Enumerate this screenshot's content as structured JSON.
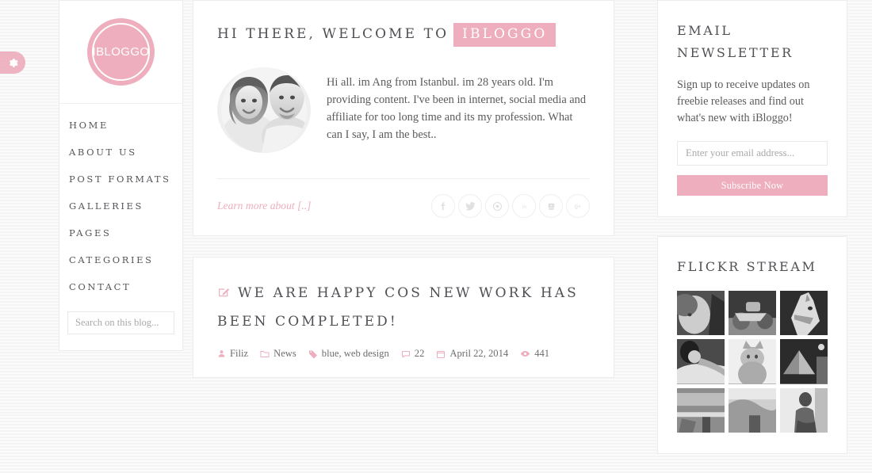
{
  "theme": {
    "accent": "#eeaebe",
    "text_dark": "#4f5054",
    "text_body": "#5b5b5b",
    "panel_bg": "#ffffff",
    "page_bg": "#f7f7f7"
  },
  "gear_tab": {
    "icon": "gear-icon"
  },
  "sidebar": {
    "logo_text": "IBLOGGO",
    "nav": [
      {
        "label": "HOME"
      },
      {
        "label": "ABOUT US"
      },
      {
        "label": "POST FORMATS"
      },
      {
        "label": "GALLERIES"
      },
      {
        "label": "PAGES"
      },
      {
        "label": "CATEGORIES"
      },
      {
        "label": "CONTACT"
      }
    ],
    "search": {
      "placeholder": "Search on this blog...",
      "value": ""
    }
  },
  "welcome": {
    "title_plain": "HI THERE, WELCOME TO",
    "title_highlight": "IBLOGGO",
    "avatar_alt": "two-people-photo",
    "body": "Hi all. im Ang from Istanbul. im 28 years old. I'm providing content. I've been in internet, social media and affiliate for too long time and its my profession. What can I say, I am the best..",
    "learn_more": "Learn more about [..]",
    "socials": [
      {
        "name": "facebook-icon",
        "glyph": "f"
      },
      {
        "name": "twitter-icon",
        "glyph": "t"
      },
      {
        "name": "pinterest-icon",
        "glyph": "p"
      },
      {
        "name": "linkedin-icon",
        "glyph": "in"
      },
      {
        "name": "youtube-icon",
        "glyph": "yt"
      },
      {
        "name": "googleplus-icon",
        "glyph": "g+"
      }
    ]
  },
  "post": {
    "title": "WE ARE HAPPY COS NEW WORK HAS BEEN COMPLETED!",
    "meta": {
      "author": "Filiz",
      "category": "News",
      "tags": "blue, web design",
      "comments": "22",
      "date": "April 22, 2014",
      "views": "441"
    }
  },
  "newsletter": {
    "title": "EMAIL NEWSLETTER",
    "text": "Sign up to receive updates on freebie releases and find out what's new with iBloggo!",
    "input_placeholder": "Enter your email address...",
    "input_value": "",
    "button_label": "Subscribe Now"
  },
  "flickr": {
    "title": "FLICKR STREAM",
    "thumbs": [
      {
        "alt": "portrait-woman"
      },
      {
        "alt": "motorcycle"
      },
      {
        "alt": "horse-head"
      },
      {
        "alt": "woman-resting"
      },
      {
        "alt": "cat"
      },
      {
        "alt": "louvre-pyramid"
      },
      {
        "alt": "blue-machinery"
      },
      {
        "alt": "blurred-scene"
      },
      {
        "alt": "seated-figure"
      }
    ]
  }
}
